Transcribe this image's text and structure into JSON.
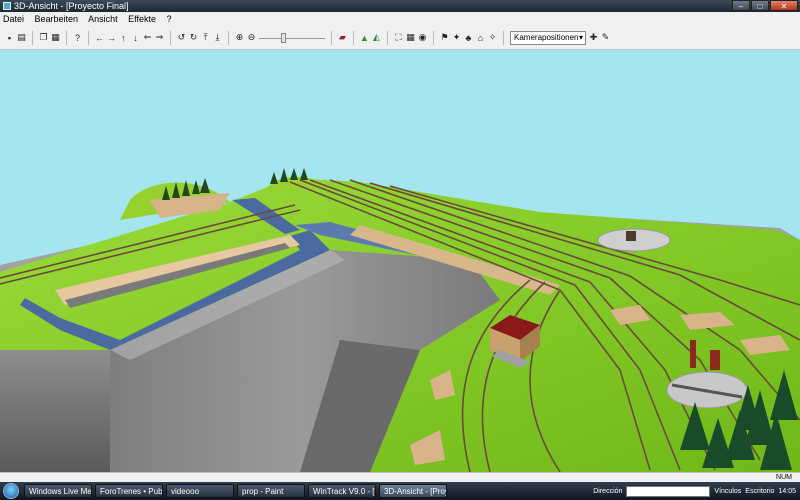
{
  "window": {
    "title": "3D-Ansicht - [Proyecto Final]"
  },
  "window_controls": {
    "minimize": "–",
    "maximize": "□",
    "close": "✕"
  },
  "menu": [
    "Datei",
    "Bearbeiten",
    "Ansicht",
    "Effekte",
    "?"
  ],
  "toolbar": {
    "camera_select": "Kamerapositionen",
    "icons": [
      "save-icon",
      "print-icon",
      "copy-icon",
      "paste-icon",
      "help-icon",
      "arrow-left-icon",
      "arrow-right-icon",
      "arrow-up-icon",
      "arrow-down-icon",
      "rotate-left-icon",
      "rotate-right-icon",
      "zoom-in-icon",
      "zoom-out-icon",
      "train-icon",
      "landscape-icon",
      "camera-icon"
    ]
  },
  "status": {
    "indicator": "NUM"
  },
  "taskbar": {
    "tasks": [
      "Windows Live Mes...",
      "ForoTrenes • Publi...",
      "videooo",
      "prop - Paint",
      "WinTrack V9.0 - [...]",
      "3D-Ansicht - [Proy..."
    ],
    "active_index": 5,
    "address_label": "Dirección",
    "links_label": "Vínculos",
    "desktop_label": "Escritorio",
    "clock": "14:05"
  },
  "colors": {
    "sky": "#a5e5f0",
    "grass": "#8fd42a",
    "cliff": "#8c8c8c",
    "water": "#4a6aa0",
    "station_roof": "#8a1a1a"
  }
}
